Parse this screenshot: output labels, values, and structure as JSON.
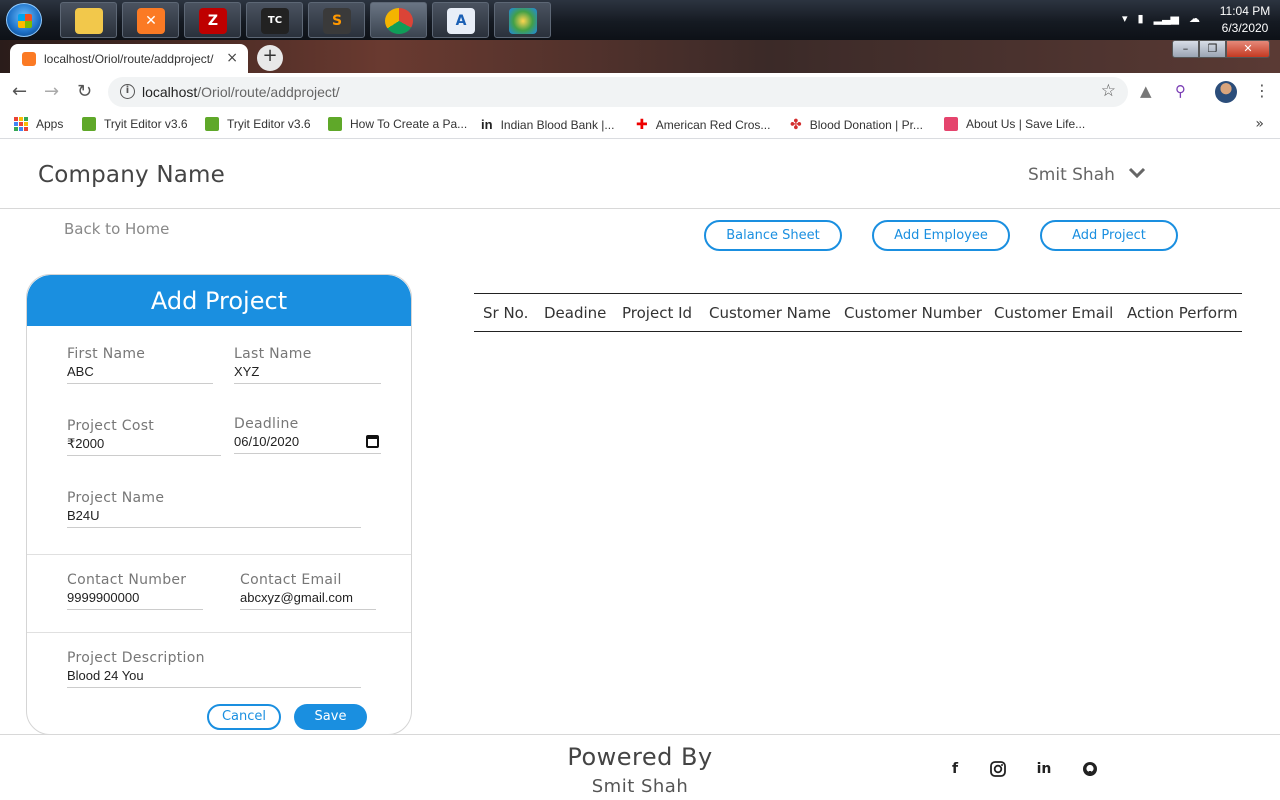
{
  "taskbar": {
    "clock_time": "11:04 PM",
    "clock_date": "6/3/2020",
    "apps": [
      "file-explorer",
      "xampp",
      "filezilla",
      "ms-office",
      "sublime-text",
      "chrome",
      "notepad",
      "paint"
    ]
  },
  "browser": {
    "tab_title": "localhost/Oriol/route/addproject/",
    "tab_close": "×",
    "newtab": "+",
    "url_host": "localhost",
    "url_path": "/Oriol/route/addproject/",
    "bookmarks": [
      {
        "label": "Apps",
        "icon": "apps-grid-icon"
      },
      {
        "label": "Tryit Editor v3.6",
        "icon": "w3schools-icon"
      },
      {
        "label": "Tryit Editor v3.6",
        "icon": "w3schools-icon"
      },
      {
        "label": "How To Create a Pa...",
        "icon": "w3schools-icon"
      },
      {
        "label": "Indian Blood Bank |...",
        "icon": "linkedin-icon"
      },
      {
        "label": "American Red Cros...",
        "icon": "red-cross-icon"
      },
      {
        "label": "Blood Donation | Pr...",
        "icon": "blood-drop-icon"
      },
      {
        "label": "About Us | Save Life...",
        "icon": "heart-icon"
      }
    ],
    "more": "»"
  },
  "header": {
    "brand": "Company Name",
    "user": "Smit Shah"
  },
  "nav": {
    "back": "Back to Home",
    "buttons": [
      "Balance Sheet",
      "Add Employee",
      "Add Project"
    ]
  },
  "form": {
    "title": "Add Project",
    "first_name_label": "First Name",
    "first_name": "ABC",
    "last_name_label": "Last Name",
    "last_name": "XYZ",
    "project_cost_label": "Project Cost",
    "project_cost": "₹2000",
    "deadline_label": "Deadline",
    "deadline": "06/10/2020",
    "project_name_label": "Project Name",
    "project_name": "B24U",
    "contact_number_label": "Contact Number",
    "contact_number": "9999900000",
    "contact_email_label": "Contact Email",
    "contact_email": "abcxyz@gmail.com",
    "description_label": "Project Description",
    "description": "Blood 24 You",
    "cancel": "Cancel",
    "save": "Save"
  },
  "table": {
    "columns": [
      "Sr No.",
      "Deadine",
      "Project Id",
      "Customer Name",
      "Customer Number",
      "Customer Email",
      "Action Perform"
    ]
  },
  "footer": {
    "powered": "Powered By",
    "author": "Smit Shah",
    "social": [
      "facebook-icon",
      "instagram-icon",
      "linkedin-icon",
      "github-icon"
    ]
  },
  "colors": {
    "accent": "#1a8fe0",
    "text": "#444444"
  }
}
